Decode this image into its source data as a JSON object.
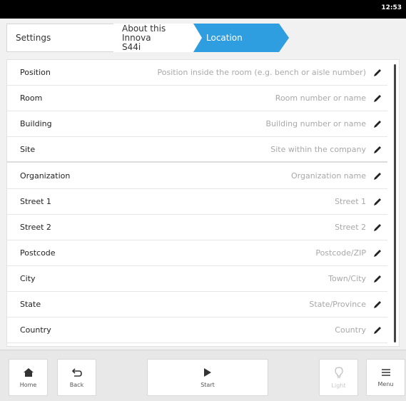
{
  "status_bar": {
    "time": "12:53"
  },
  "breadcrumb": {
    "items": [
      {
        "label": "Settings"
      },
      {
        "label_line1": "About this Innova",
        "label_line2": "S44i"
      },
      {
        "label": "Location"
      }
    ]
  },
  "colors": {
    "accent": "#2f9ee0",
    "placeholder": "#a8a8a8",
    "text": "#222222"
  },
  "fields": [
    {
      "label": "Position",
      "placeholder": "Position inside the room (e.g. bench or aisle number)"
    },
    {
      "label": "Room",
      "placeholder": "Room number or name"
    },
    {
      "label": "Building",
      "placeholder": "Building number or name"
    },
    {
      "label": "Site",
      "placeholder": "Site within the company"
    },
    {
      "label": "Organization",
      "placeholder": "Organization name"
    },
    {
      "label": "Street 1",
      "placeholder": "Street 1"
    },
    {
      "label": "Street 2",
      "placeholder": "Street 2"
    },
    {
      "label": "Postcode",
      "placeholder": "Postcode/ZIP"
    },
    {
      "label": "City",
      "placeholder": "Town/City"
    },
    {
      "label": "State",
      "placeholder": "State/Province"
    },
    {
      "label": "Country",
      "placeholder": "Country"
    }
  ],
  "bottom_bar": {
    "home": {
      "label": "Home",
      "icon": "home-icon"
    },
    "back": {
      "label": "Back",
      "icon": "back-icon"
    },
    "start": {
      "label": "Start",
      "icon": "play-icon"
    },
    "light": {
      "label": "Light",
      "icon": "lightbulb-icon",
      "enabled": false
    },
    "menu": {
      "label": "Menu",
      "icon": "menu-icon"
    }
  }
}
